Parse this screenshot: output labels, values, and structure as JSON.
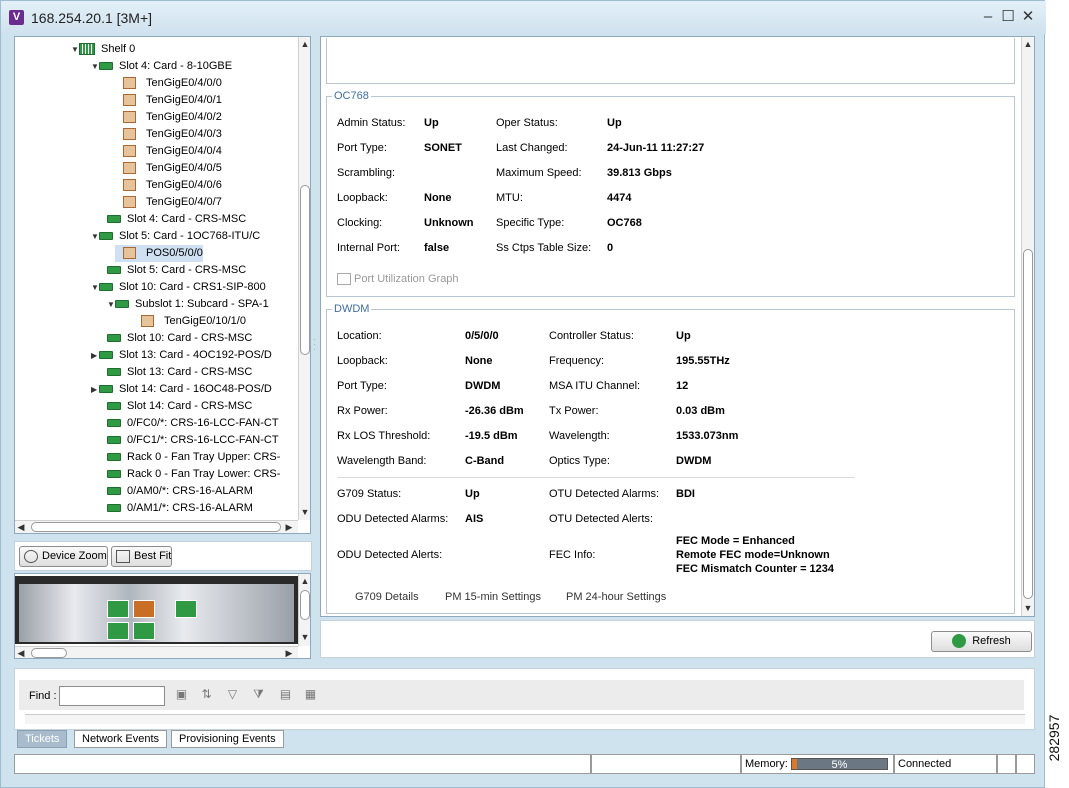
{
  "window": {
    "title": "168.254.20.1 [3M+]",
    "app_icon": "V"
  },
  "tree": [
    {
      "label": "Shelf 0",
      "icon": "shelf",
      "expander": "▼"
    },
    {
      "label": "Slot 4: Card - 8-10GBE",
      "icon": "card",
      "expander": "▼"
    },
    {
      "label": "TenGigE0/4/0/0",
      "icon": "port"
    },
    {
      "label": "TenGigE0/4/0/1",
      "icon": "port"
    },
    {
      "label": "TenGigE0/4/0/2",
      "icon": "port"
    },
    {
      "label": "TenGigE0/4/0/3",
      "icon": "port"
    },
    {
      "label": "TenGigE0/4/0/4",
      "icon": "port"
    },
    {
      "label": "TenGigE0/4/0/5",
      "icon": "port"
    },
    {
      "label": "TenGigE0/4/0/6",
      "icon": "port"
    },
    {
      "label": "TenGigE0/4/0/7",
      "icon": "port"
    },
    {
      "label": "Slot 4: Card - CRS-MSC",
      "icon": "card"
    },
    {
      "label": "Slot 5: Card - 1OC768-ITU/C",
      "icon": "card",
      "expander": "▼"
    },
    {
      "label": "POS0/5/0/0",
      "icon": "port",
      "selected": true
    },
    {
      "label": "Slot 5: Card - CRS-MSC",
      "icon": "card"
    },
    {
      "label": "Slot 10: Card - CRS1-SIP-800",
      "icon": "card",
      "expander": "▼"
    },
    {
      "label": "Subslot 1: Subcard - SPA-1",
      "icon": "card",
      "expander": "▼"
    },
    {
      "label": "TenGigE0/10/1/0",
      "icon": "port"
    },
    {
      "label": "Slot 10: Card - CRS-MSC",
      "icon": "card"
    },
    {
      "label": "Slot 13: Card - 4OC192-POS/D",
      "icon": "card",
      "expander": "▶"
    },
    {
      "label": "Slot 13: Card - CRS-MSC",
      "icon": "card"
    },
    {
      "label": "Slot 14: Card - 16OC48-POS/D",
      "icon": "card",
      "expander": "▶"
    },
    {
      "label": "Slot 14: Card - CRS-MSC",
      "icon": "card"
    },
    {
      "label": "0/FC0/*: CRS-16-LCC-FAN-CT",
      "icon": "card"
    },
    {
      "label": "0/FC1/*: CRS-16-LCC-FAN-CT",
      "icon": "card"
    },
    {
      "label": "Rack 0 - Fan Tray Upper: CRS-",
      "icon": "card"
    },
    {
      "label": "Rack 0 - Fan Tray Lower: CRS-",
      "icon": "card"
    },
    {
      "label": "0/AM0/*: CRS-16-ALARM",
      "icon": "card"
    },
    {
      "label": "0/AM1/*: CRS-16-ALARM",
      "icon": "card"
    }
  ],
  "zoom": {
    "device_zoom": "Device Zoom",
    "best_fit": "Best Fit"
  },
  "oc768": {
    "title": "OC768",
    "left": [
      [
        "Admin Status:",
        "Up"
      ],
      [
        "Port Type:",
        "SONET"
      ],
      [
        "Scrambling:",
        ""
      ],
      [
        "Loopback:",
        "None"
      ],
      [
        "Clocking:",
        "Unknown"
      ],
      [
        "Internal Port:",
        "false"
      ]
    ],
    "right": [
      [
        "Oper Status:",
        "Up"
      ],
      [
        "Last Changed:",
        "24-Jun-11 11:27:27"
      ],
      [
        "Maximum Speed:",
        "39.813 Gbps"
      ],
      [
        "MTU:",
        "4474"
      ],
      [
        "Specific Type:",
        "OC768"
      ],
      [
        "Ss Ctps Table Size:",
        "0"
      ]
    ],
    "graph_link": "Port Utilization Graph"
  },
  "dwdm": {
    "title": "DWDM",
    "left": [
      [
        "Location:",
        "0/5/0/0"
      ],
      [
        "Loopback:",
        "None"
      ],
      [
        "Port Type:",
        "DWDM"
      ],
      [
        "Rx Power:",
        "-26.36 dBm"
      ],
      [
        "Rx LOS Threshold:",
        "-19.5 dBm"
      ],
      [
        "Wavelength Band:",
        "C-Band"
      ]
    ],
    "right": [
      [
        "Controller Status:",
        "Up"
      ],
      [
        "Frequency:",
        "195.55THz"
      ],
      [
        "MSA ITU Channel:",
        "12"
      ],
      [
        "Tx Power:",
        "0.03 dBm"
      ],
      [
        "Wavelength:",
        "1533.073nm"
      ],
      [
        "Optics Type:",
        "DWDM"
      ]
    ],
    "g709_status_label": "G709 Status:",
    "g709_status": "Up",
    "otu_alarms_label": "OTU Detected Alarms:",
    "otu_alarms": "BDI",
    "odu_alarms_label": "ODU Detected Alarms:",
    "odu_alarms": "AIS",
    "otu_alerts_label": "OTU Detected Alerts:",
    "odu_alerts_label": "ODU Detected Alerts:",
    "fec_info_label": "FEC Info:",
    "fec_lines": [
      "FEC Mode = Enhanced",
      "Remote FEC mode=Unknown",
      "FEC Mismatch Counter = 1234"
    ],
    "links": [
      "G709 Details",
      "PM 15-min Settings",
      "PM 24-hour Settings"
    ]
  },
  "refresh": "Refresh",
  "find": {
    "label": "Find :",
    "value": ""
  },
  "tabs": [
    "Tickets",
    "Network Events",
    "Provisioning Events"
  ],
  "status": {
    "memory_label": "Memory:",
    "memory_value": "5%",
    "memory_fraction": 0.05,
    "connection": "Connected"
  },
  "figure_id": "282957"
}
